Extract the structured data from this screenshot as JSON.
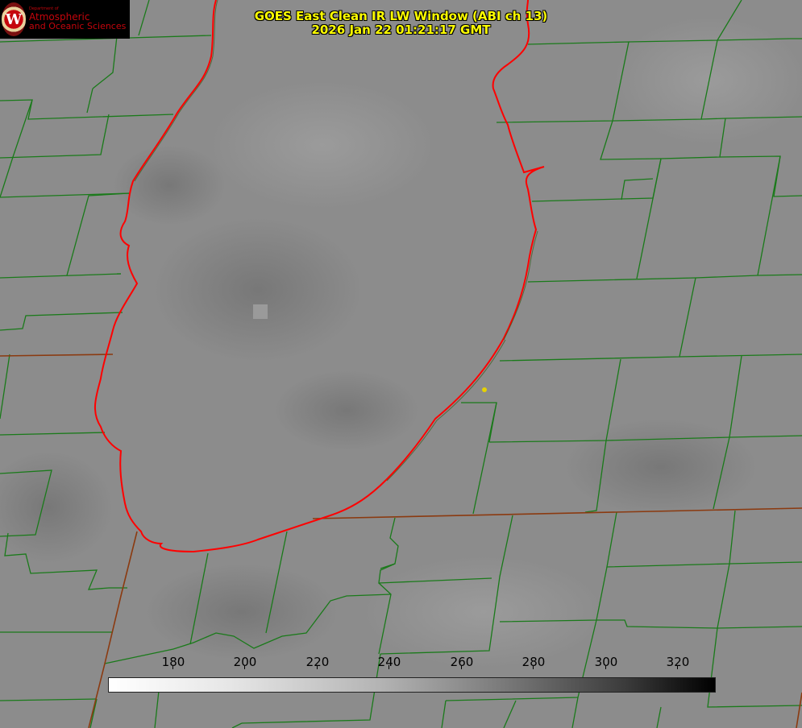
{
  "header": {
    "title_line1": "GOES East Clean IR LW Window (ABI ch 13)",
    "title_line2": "2026 Jan 22 01:21:17 GMT"
  },
  "logo": {
    "line_small": "Department of",
    "line1": "Atmospheric",
    "line2": "and Oceanic Sciences",
    "seal_letter": "W"
  },
  "colorbar": {
    "ticks": [
      "180",
      "200",
      "220",
      "240",
      "260",
      "280",
      "300",
      "320"
    ]
  },
  "colors": {
    "title": "#ffff00",
    "county_lines": "#1a7a1a",
    "state_lines": "#8b3a10",
    "lake_outline": "#ff0000",
    "station_marker": "#e6d200"
  }
}
